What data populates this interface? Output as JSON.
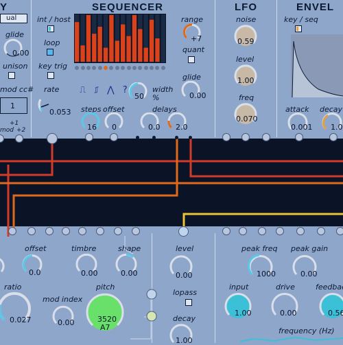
{
  "headers": {
    "y": "Y",
    "sequencer": "SEQUENCER",
    "lfo": "LFO",
    "envelope": "ENVEL"
  },
  "left": {
    "mode_value": "ual",
    "glide_label": "glide",
    "glide_value": "0.00",
    "unison_label": "unison",
    "mod_cc_label": "mod cc#",
    "mod_cc_value": "1",
    "ports_plus1": "+1",
    "ports_mod": "mod",
    "ports_plus2": "+2"
  },
  "sequencer": {
    "int_host_label": "int / host",
    "loop_label": "loop",
    "key_trig_label": "key trig",
    "rate_label": "rate",
    "rate_value": "0.053",
    "steps_label": "steps",
    "steps_value": "16",
    "offset_label": "offset",
    "offset_value": "0",
    "width_label": "width",
    "width_value": "50",
    "width_unit": "%",
    "delays_label": "delays",
    "delay1_value": "0.0",
    "delay2_value": "2.0",
    "range_label": "range",
    "range_value": "+7",
    "quant_label": "quant",
    "glide_label": "glide",
    "glide_value": "0.00",
    "shape_symbols": "⎍ ⎎ ⋀ ?",
    "steps": [
      0.85,
      0.35,
      1.0,
      0.6,
      0.75,
      0.3,
      1.0,
      0.45,
      0.8,
      0.55,
      1.0,
      0.7,
      0.3,
      0.9,
      0.5,
      0.0
    ]
  },
  "lfo": {
    "noise_label": "noise",
    "noise_value": "0.59",
    "level_label": "level",
    "level_value": "1.00",
    "freq_label": "freq",
    "freq_value": "0.070"
  },
  "envelope": {
    "key_seq_label": "key / seq",
    "attack_label": "attack",
    "attack_value": "0.001",
    "decay_label": "decay",
    "decay_value": "1.0"
  },
  "bottom_left": {
    "offset_label": "offset",
    "offset_value": "0.0",
    "ratio_label": "ratio",
    "ratio_value": "0.027",
    "timbre_label": "timbre",
    "timbre_value": "0.00",
    "shape_label": "shape",
    "shape_value": "0.00",
    "mod_index_label": "mod index",
    "mod_index_value": "0.00",
    "pitch_label": "pitch",
    "pitch_value": "3520",
    "pitch_note": "A7"
  },
  "bottom_mid": {
    "level_label": "level",
    "level_value": "0.00",
    "lopass_label": "lopass",
    "decay_label": "decay",
    "decay_value": "1.00"
  },
  "bottom_right": {
    "peak_freq_label": "peak freq",
    "peak_freq_value": "1000",
    "peak_gain_label": "peak gain",
    "peak_gain_value": "0.00",
    "input_label": "input",
    "input_value": "1.00",
    "drive_label": "drive",
    "drive_value": "0.00",
    "feedback_label": "feedback",
    "feedback_value": "0.56",
    "frequency_label": "frequency (Hz)"
  },
  "colors": {
    "panel": "#8fa6cb",
    "patchbay": "#0b1426",
    "seq_bg": "#0b1426",
    "seq_bar": "#d9421a",
    "wire_red": "#d23a2a",
    "wire_orange": "#e06a1c",
    "wire_yellow": "#e8c53a",
    "knob_arc_light": "#d8dfe9",
    "knob_green": "#69e06a",
    "knob_cyan": "#3cc0d8"
  }
}
